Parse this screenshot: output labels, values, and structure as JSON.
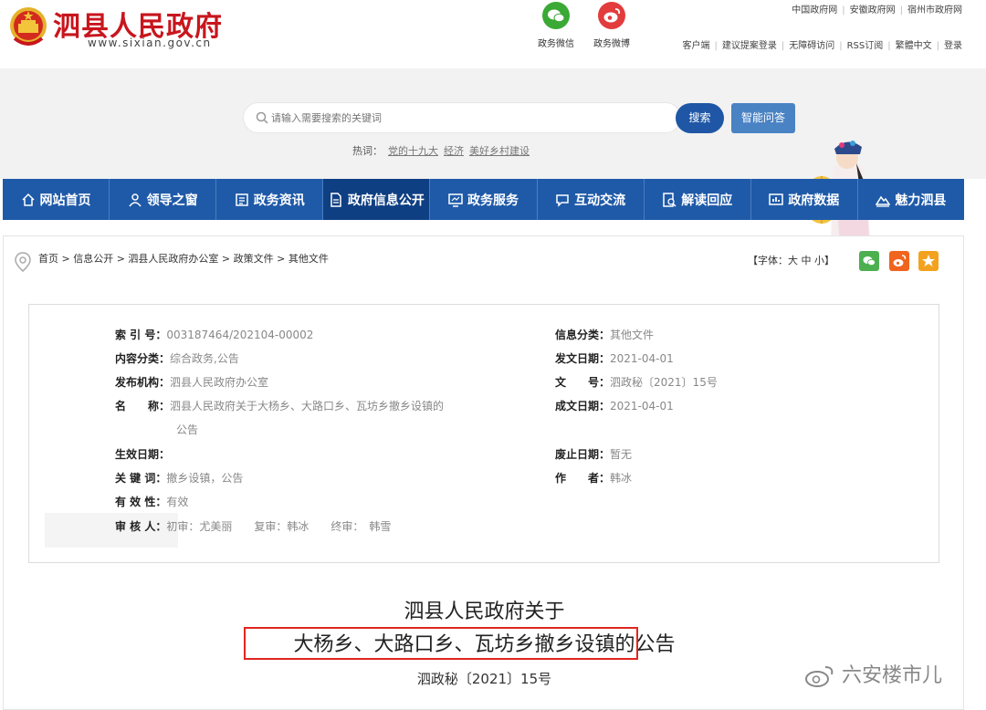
{
  "header": {
    "site_title": "泗县人民政府",
    "site_url": "www.sixian.gov.cn",
    "social": [
      {
        "label": "政务微信",
        "icon": "wechat-icon"
      },
      {
        "label": "政务微博",
        "icon": "weibo-icon"
      }
    ],
    "top_links": [
      "中国政府网",
      "安徽政府网",
      "宿州市政府网"
    ],
    "bottom_links": [
      "客户端",
      "建议提案登录",
      "无障碍访问",
      "RSS订阅",
      "繁體中文",
      "登录"
    ]
  },
  "search": {
    "placeholder": "请输入需要搜索的关键词",
    "button": "搜索",
    "qa_button": "智能问答",
    "hot_label": "热词：",
    "hot_words": [
      "党的十九大",
      "经济",
      "美好乡村建设"
    ]
  },
  "nav": [
    {
      "label": "网站首页",
      "icon": "home-icon"
    },
    {
      "label": "领导之窗",
      "icon": "user-icon"
    },
    {
      "label": "政务资讯",
      "icon": "news-icon"
    },
    {
      "label": "政府信息公开",
      "icon": "document-icon",
      "active": true
    },
    {
      "label": "政务服务",
      "icon": "monitor-icon"
    },
    {
      "label": "互动交流",
      "icon": "chat-icon"
    },
    {
      "label": "解读回应",
      "icon": "search-doc-icon"
    },
    {
      "label": "政府数据",
      "icon": "chart-icon"
    },
    {
      "label": "魅力泗县",
      "icon": "mountain-icon"
    }
  ],
  "breadcrumb": "首页 > 信息公开 > 泗县人民政府办公室 > 政策文件 > 其他文件",
  "font_ctrl": "【字体：大 中 小】",
  "meta": {
    "left": [
      {
        "k": "索 引 号：",
        "v": "003187464/202104-00002"
      },
      {
        "k": "内容分类：",
        "v": "综合政务,公告"
      },
      {
        "k": "发布机构：",
        "v": "泗县人民政府办公室"
      },
      {
        "k": "名　　称：",
        "v": "泗县人民政府关于大杨乡、大路口乡、瓦坊乡撤乡设镇的",
        "v2": "公告"
      },
      {
        "k": "生效日期：",
        "v": ""
      },
      {
        "k": "关 键 词：",
        "v": "撤乡设镇，公告"
      },
      {
        "k": "有 效 性：",
        "v": "有效"
      },
      {
        "k": "审 核 人：",
        "v": "初审：尤美丽　　复审：韩冰　　终审：　韩雪"
      }
    ],
    "right": [
      {
        "k": "信息分类：",
        "v": "其他文件"
      },
      {
        "k": "发文日期：",
        "v": "2021-04-01"
      },
      {
        "k": "文　　号：",
        "v": "泗政秘〔2021〕15号"
      },
      {
        "k": "成文日期：",
        "v": "2021-04-01"
      },
      {
        "k": "废止日期：",
        "v": "暂无"
      },
      {
        "k": "作　　者：",
        "v": "韩冰"
      }
    ]
  },
  "document": {
    "title_line1": "泗县人民政府关于",
    "title_line2": "大杨乡、大路口乡、瓦坊乡撤乡设镇的公告",
    "number": "泗政秘〔2021〕15号"
  },
  "watermark": "六安楼市儿",
  "colors": {
    "brand_red": "#c8161d",
    "nav_blue": "#1f5aa8",
    "highlight_red": "#e0271f"
  }
}
